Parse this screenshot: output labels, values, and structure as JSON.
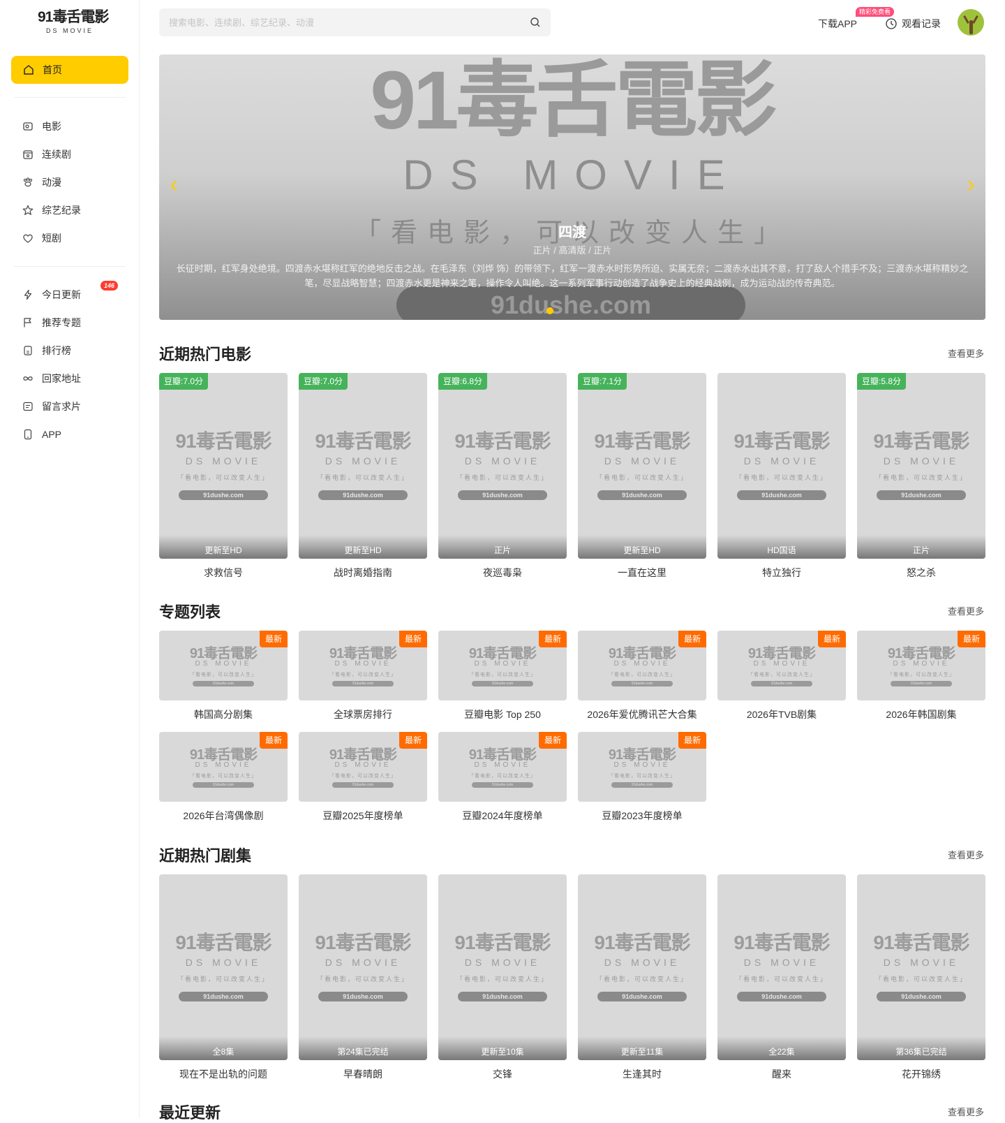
{
  "site": {
    "logo_brand": "91毒舌電影",
    "logo_sub": "DS MOVIE"
  },
  "sidebar": {
    "home_label": "首页",
    "items": [
      {
        "label": "电影",
        "icon": "movie-icon"
      },
      {
        "label": "连续剧",
        "icon": "tv-icon"
      },
      {
        "label": "动漫",
        "icon": "paw-icon"
      },
      {
        "label": "综艺纪录",
        "icon": "star-icon"
      },
      {
        "label": "短剧",
        "icon": "heart-icon"
      }
    ],
    "items2": [
      {
        "label": "今日更新",
        "icon": "bolt-icon"
      },
      {
        "label": "推荐专题",
        "icon": "flag-icon"
      },
      {
        "label": "排行榜",
        "icon": "ranking-icon"
      },
      {
        "label": "回家地址",
        "icon": "infinity-icon"
      },
      {
        "label": "留言求片",
        "icon": "message-icon"
      },
      {
        "label": "APP",
        "icon": "phone-icon"
      }
    ],
    "today_badge": "146"
  },
  "search": {
    "placeholder": "搜索电影、连续剧、综艺纪录、动漫"
  },
  "header": {
    "download_label": "下载APP",
    "download_tag": "精彩免费看",
    "history_label": "观看记录"
  },
  "banner": {
    "title": "四渡",
    "meta": "正片 / 高清版 / 正片",
    "description": "长征时期，红军身处绝境。四渡赤水堪称红军的绝地反击之战。在毛泽东（刘烨 饰）的带领下，红军一渡赤水时形势所迫、实属无奈；二渡赤水出其不意，打了敌人个措手不及；三渡赤水堪称精妙之笔，尽显战略智慧；四渡赤水更是神来之笔，操作令人叫绝。这一系列军事行动创造了战争史上的经典战例，成为运动战的传奇典范。",
    "wm_brand": "91毒舌電影",
    "wm_sub": "DS MOVIE",
    "wm_slogan": "「看电影，可以改变人生」",
    "wm_url": "91dushe.com"
  },
  "poster_wm": {
    "brand": "91毒舌電影",
    "sub": "DS MOVIE",
    "slogan": "「看电影，可以改变人生」",
    "url": "91dushe.com"
  },
  "sections": {
    "hot_movies": {
      "title": "近期热门电影",
      "more": "查看更多",
      "items": [
        {
          "score": "豆瓣:7.0分",
          "status": "更新至HD",
          "name": "求救信号"
        },
        {
          "score": "豆瓣:7.0分",
          "status": "更新至HD",
          "name": "战时离婚指南"
        },
        {
          "score": "豆瓣:6.8分",
          "status": "正片",
          "name": "夜巡毒枭"
        },
        {
          "score": "豆瓣:7.1分",
          "status": "更新至HD",
          "name": "一直在这里"
        },
        {
          "score": "",
          "status": "HD国语",
          "name": "特立独行"
        },
        {
          "score": "豆瓣:5.8分",
          "status": "正片",
          "name": "怒之杀"
        }
      ]
    },
    "topics": {
      "title": "专题列表",
      "more": "查看更多",
      "new_label": "最新",
      "items": [
        {
          "name": "韩国高分剧集"
        },
        {
          "name": "全球票房排行"
        },
        {
          "name": "豆瓣电影 Top 250"
        },
        {
          "name": "2026年爱优腾讯芒大合集"
        },
        {
          "name": "2026年TVB剧集"
        },
        {
          "name": "2026年韩国剧集"
        },
        {
          "name": "2026年台湾偶像剧"
        },
        {
          "name": "豆瓣2025年度榜单"
        },
        {
          "name": "豆瓣2024年度榜单"
        },
        {
          "name": "豆瓣2023年度榜单"
        }
      ]
    },
    "hot_series": {
      "title": "近期热门剧集",
      "more": "查看更多",
      "items": [
        {
          "status": "全8集",
          "name": "现在不是出轨的问题"
        },
        {
          "status": "第24集已完结",
          "name": "早春晴朗"
        },
        {
          "status": "更新至10集",
          "name": "交锋"
        },
        {
          "status": "更新至11集",
          "name": "生逢其时"
        },
        {
          "status": "全22集",
          "name": "醒来"
        },
        {
          "status": "第36集已完结",
          "name": "花开锦绣"
        }
      ]
    },
    "recent": {
      "title": "最近更新",
      "more": "查看更多"
    }
  },
  "colors": {
    "accent": "#ffcc00",
    "score_green": "#46b35b",
    "new_orange": "#ff6b00",
    "badge_red": "#ff3b30",
    "tag_pink": "#ff4d79"
  }
}
